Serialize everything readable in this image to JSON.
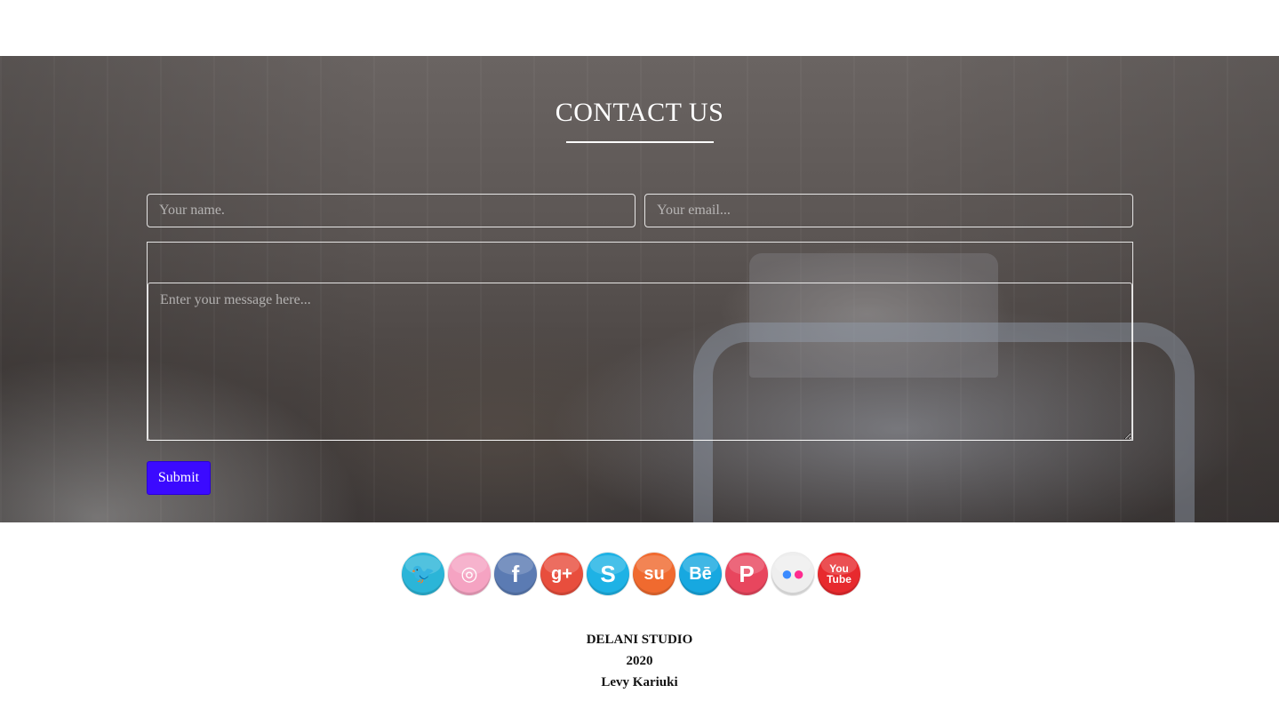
{
  "contact": {
    "title": "CONTACT US",
    "name_placeholder": "Your name.",
    "email_placeholder": "Your email...",
    "message_placeholder": "Enter your message here...",
    "submit_label": "Submit"
  },
  "social": [
    {
      "icon": "twitter-icon",
      "glyph": "🐦",
      "color": "#2bb5d8"
    },
    {
      "icon": "dribbble-icon",
      "glyph": "◎",
      "color": "#f5a3c2"
    },
    {
      "icon": "facebook-icon",
      "glyph": "f",
      "color": "#5b7bb3"
    },
    {
      "icon": "google-plus-icon",
      "glyph": "g+",
      "color": "#e84e3d"
    },
    {
      "icon": "skype-icon",
      "glyph": "S",
      "color": "#1eb2e5"
    },
    {
      "icon": "stumbleupon-icon",
      "glyph": "su",
      "color": "#f06a2f"
    },
    {
      "icon": "behance-icon",
      "glyph": "Bē",
      "color": "#17a8e0"
    },
    {
      "icon": "pinterest-icon",
      "glyph": "P",
      "color": "#e8465e"
    },
    {
      "icon": "flickr-icon",
      "glyph": "●●",
      "color": "#eeeeee"
    },
    {
      "icon": "youtube-icon",
      "glyph": "You\nTube",
      "color": "#e72a2e"
    }
  ],
  "footer": {
    "studio": "DELANI STUDIO",
    "year": "2020",
    "author": "Levy Kariuki"
  }
}
